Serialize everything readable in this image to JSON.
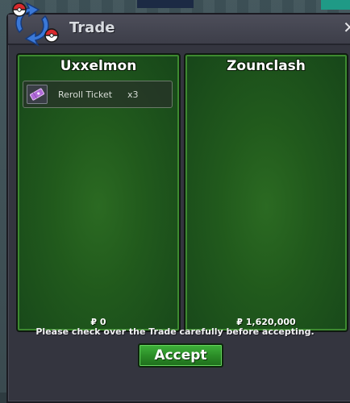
{
  "window": {
    "title": "Trade",
    "close_label": "✕"
  },
  "left_panel": {
    "player_name": "Uxxelmon",
    "items": [
      {
        "name": "Reroll Ticket",
        "quantity": "x3",
        "icon": "ticket-icon"
      }
    ],
    "money": "₽ 0"
  },
  "right_panel": {
    "player_name": "Zounclash",
    "items": [],
    "money": "₽ 1,620,000"
  },
  "notice": "Please check over the Trade carefully before accepting.",
  "accept_label": "Accept",
  "colors": {
    "panel_green": "#215a1c",
    "accent_green": "#2a8a26",
    "window_bg": "#34353f"
  }
}
